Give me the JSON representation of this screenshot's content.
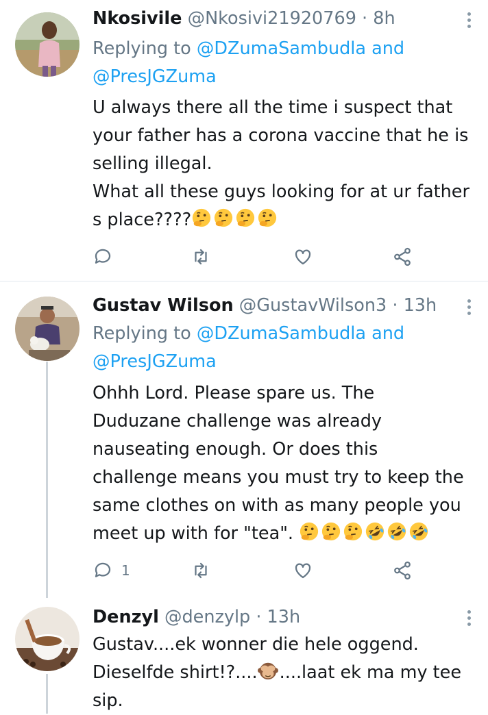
{
  "tweets": [
    {
      "name": "Nkosivile",
      "handle": "@Nkosivi21920769",
      "time": "· 8h",
      "replying_prefix": "Replying to ",
      "mention1": "@DZumaSambudla",
      "and_text": " and",
      "mention2": "@PresJGZuma",
      "lines": [
        "U always there all the time i suspect  that",
        "your father has a corona vaccine that he is",
        "selling illegal.",
        "What all these guys looking for at ur father",
        "s place????"
      ],
      "emojis": [
        "thinking-face",
        "thinking-face",
        "thinking-face",
        "thinking-face"
      ],
      "reply_count": ""
    },
    {
      "name": "Gustav Wilson",
      "handle": "@GustavWilson3",
      "time": "· 13h",
      "replying_prefix": "Replying to ",
      "mention1": "@DZumaSambudla",
      "and_text": " and",
      "mention2": "@PresJGZuma",
      "lines": [
        "Ohhh Lord. Please spare us. The",
        "Duduzane challenge was already",
        "nauseating enough. Or does this",
        "challenge means you must try to keep the",
        "same clothes on with as many people you",
        "meet up with for \"tea\". "
      ],
      "emojis": [
        "thinking-face",
        "thinking-face",
        "thinking-face",
        "rofl-face",
        "rofl-face",
        "rofl-face"
      ],
      "reply_count": "1"
    },
    {
      "name": "Denzyl",
      "handle": "@denzylp",
      "time": "· 13h",
      "lines": [
        "Gustav....ek wonner die hele oggend.",
        "Dieselfde shirt!?....",
        "....laat ek ma my tee",
        "sip."
      ],
      "emojis": [
        "see-no-evil-monkey"
      ]
    }
  ]
}
